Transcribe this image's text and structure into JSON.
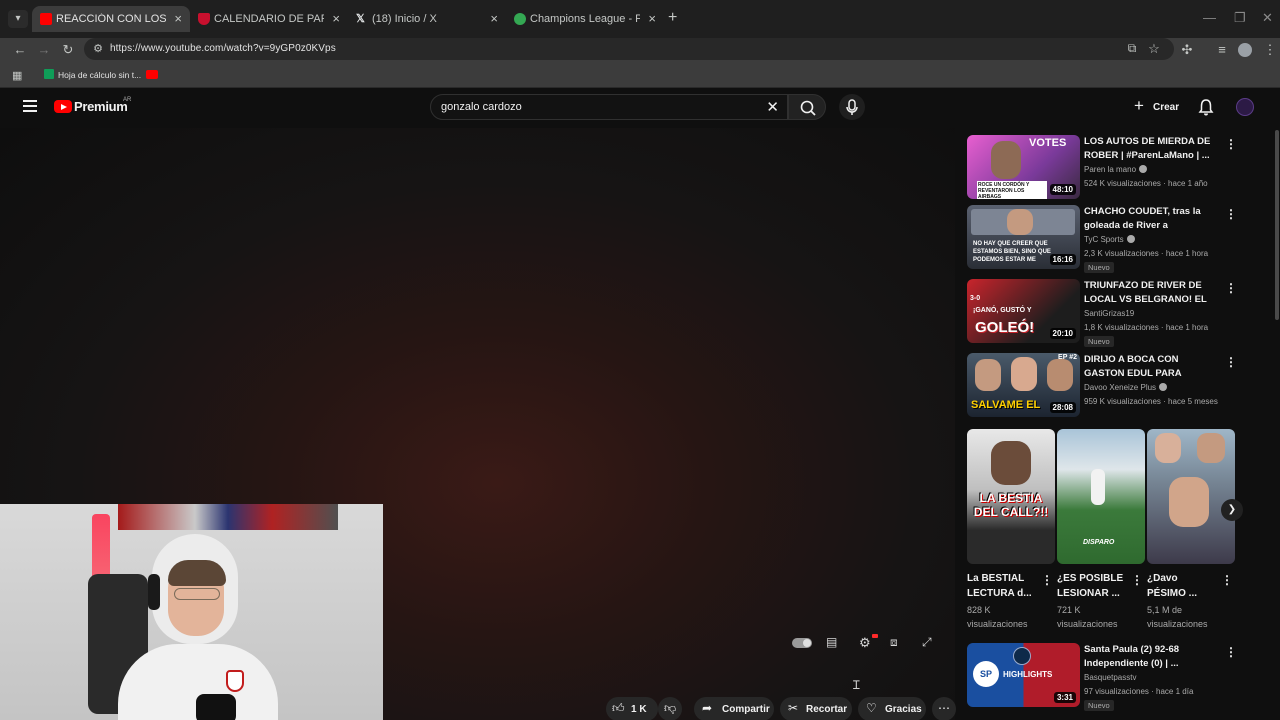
{
  "browser": {
    "tabs": [
      {
        "title": "REACCIÓN CON LOS HINCHAS",
        "favicon_color": "#ff0000",
        "active": true
      },
      {
        "title": "CALENDARIO DE PARTIDOS",
        "favicon_color": "#c8102e",
        "active": false
      },
      {
        "title": "(18) Inicio / X",
        "favicon_color": "#e7e9ea",
        "active": false
      },
      {
        "title": "Champions League - POSICIONES",
        "favicon_color": "#34a853",
        "active": false
      }
    ],
    "url": "https://www.youtube.com/watch?v=9yGP0z0KVps",
    "bookmarks": [
      {
        "label": "Hoja de cálculo sin t..."
      }
    ]
  },
  "masthead": {
    "logo_text": "Premium",
    "region": "AR",
    "search_value": "gonzalo cardozo",
    "create_label": "Crear"
  },
  "actions": {
    "like_count": "1 K",
    "share_label": "Compartir",
    "clip_label": "Recortar",
    "thanks_label": "Gracias"
  },
  "sidebar": {
    "videos": [
      {
        "title": "LOS AUTOS DE MIERDA DE ROBER | #ParenLaMano | ...",
        "channel": "Paren la mano",
        "verified": true,
        "meta": "524 K visualizaciones · hace 1 año",
        "duration": "48:10",
        "new": false
      },
      {
        "title": "CHACHO COUDET, tras la goleada de River a Belgrano: e...",
        "channel": "TyC Sports",
        "verified": true,
        "meta": "2,3 K visualizaciones · hace 1 hora",
        "duration": "16:16",
        "new": true,
        "new_label": "Nuevo"
      },
      {
        "title": "TRIUNFAZO DE RIVER DE LOCAL VS BELGRANO! EL ...",
        "channel": "SantiGrizas19",
        "verified": false,
        "meta": "1,8 K visualizaciones · hace 1 hora",
        "duration": "20:10",
        "new": true,
        "new_label": "Nuevo"
      },
      {
        "title": "DIRIJO A BOCA CON GASTON EDUL PARA SALIR CAMPEON ...",
        "channel": "Davoo Xeneize Plus",
        "verified": true,
        "meta": "959 K visualizaciones · hace 5 meses",
        "duration": "28:08",
        "new": false
      },
      {
        "title": "Santa Paula (2) 92-68 Independiente (0) | ...",
        "channel": "Basquetpasstv",
        "verified": false,
        "meta": "97 visualizaciones · hace 1 día",
        "duration": "3:31",
        "new": true,
        "new_label": "Nuevo"
      }
    ],
    "thumb_texts": {
      "v1_banner": "VOTES",
      "v1_caption": "ROCE UN CORDÓN Y REVENTARON LOS AIRBAGS",
      "v2_caption": "NO HAY QUE CREER QUE ESTAMOS BIEN, SINO QUE PODEMOS ESTAR ME",
      "v3_top": "¡GANÓ, GUSTÓ Y",
      "v3_big": "GOLEÓ!",
      "v3_score": "3-0",
      "v4_big": "SALVAME EL",
      "v4_tag": "EP #2",
      "v5_big": "HIGHLIGHTS",
      "v5_left": "SP"
    },
    "shorts": [
      {
        "title": "La BESTIAL LECTURA d...",
        "views": "828 K visualizaciones",
        "overlay": "LA BESTIA DEL CALL?!!"
      },
      {
        "title": "¿ES POSIBLE LESIONAR ...",
        "views": "721 K visualizaciones",
        "overlay": "DISPARO"
      },
      {
        "title": "¿Davo PÉSIMO ...",
        "views": "5,1 M de visualizaciones",
        "overlay": ""
      }
    ]
  },
  "colors": {
    "accent": "#ff0000",
    "background": "#0f0f0f",
    "muted_text": "#aaaaaa"
  }
}
